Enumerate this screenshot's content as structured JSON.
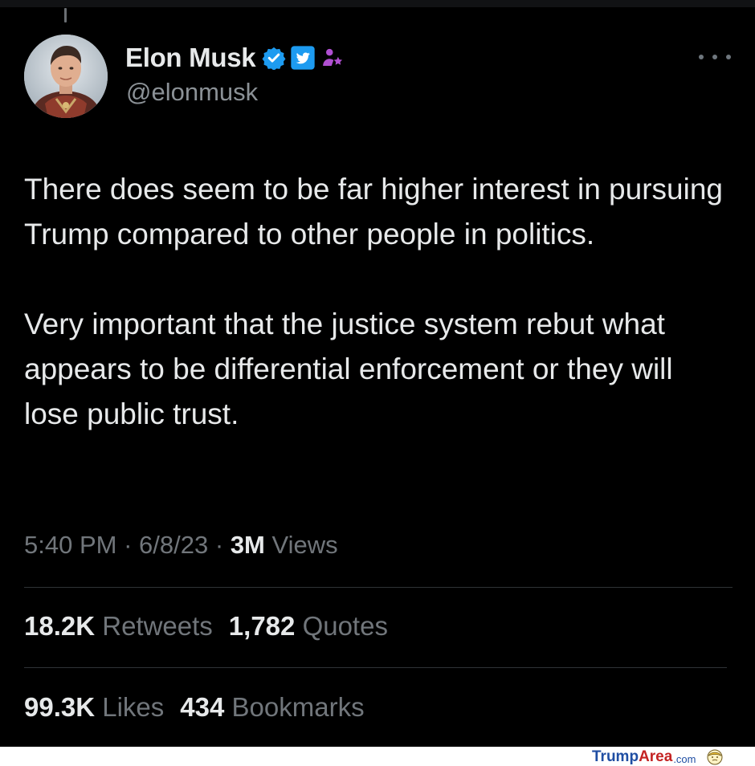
{
  "tweet": {
    "author": {
      "display_name": "Elon Musk",
      "handle": "@elonmusk",
      "badges": [
        "verified-check-icon",
        "twitter-logo-badge-icon",
        "person-star-icon"
      ]
    },
    "more_icon": "more-options-icon",
    "paragraphs": [
      "There does seem to be far higher interest in pursuing Trump compared to other people in politics.",
      "Very important that the justice system rebut what appears to be differential enforcement or they will lose public trust."
    ],
    "meta": {
      "time": "5:40 PM",
      "separator": "·",
      "date": "6/8/23",
      "views_count": "3M",
      "views_label": "Views"
    },
    "stats": {
      "retweets_count": "18.2K",
      "retweets_label": "Retweets",
      "quotes_count": "1,782",
      "quotes_label": "Quotes",
      "likes_count": "99.3K",
      "likes_label": "Likes",
      "bookmarks_count": "434",
      "bookmarks_label": "Bookmarks"
    }
  },
  "watermark": {
    "part1": "Trump",
    "part2": "Area",
    "part3": ".com"
  },
  "colors": {
    "background": "#000000",
    "text": "#e7e9ea",
    "secondary": "#71767b",
    "verified_blue": "#1d9bf0",
    "affiliate_purple": "#b04fd1",
    "watermark_blue": "#1f4ea3",
    "watermark_red": "#c42323"
  }
}
